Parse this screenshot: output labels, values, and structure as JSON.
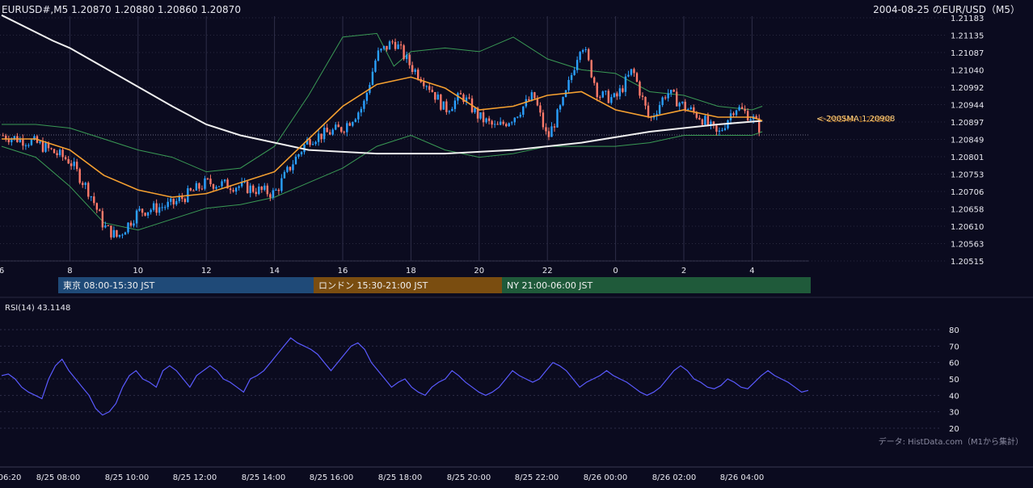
{
  "header": {
    "symbol_line": "EURUSD#,M5 1.20870 1.20880 1.20860 1.20870",
    "title": "2004-08-25 のEUR/USD（M5）"
  },
  "price_axis_labels": [
    "1.21183",
    "1.21135",
    "1.21087",
    "1.21040",
    "1.20992",
    "1.20944",
    "1.20897",
    "1.20849",
    "1.20801",
    "1.20753",
    "1.20706",
    "1.20658",
    "1.20610",
    "1.20563",
    "1.20515"
  ],
  "hour_axis_labels": [
    "6",
    "8",
    "10",
    "12",
    "14",
    "16",
    "18",
    "20",
    "22",
    "0",
    "2",
    "4"
  ],
  "ma_label": "<-200SMA 1.20908",
  "ma_label_shadow": "<-20SMA 1.20900",
  "sessions": [
    {
      "label": "東京 08:00-15:30 JST",
      "color": "#1f4a78"
    },
    {
      "label": "ロンドン 15:30-21:00 JST",
      "color": "#7a4d10"
    },
    {
      "label": "NY 21:00-06:00 JST",
      "color": "#1f5a3a"
    }
  ],
  "rsi": {
    "label": "RSI(14) 43.1148",
    "axis_labels": [
      "80",
      "70",
      "60",
      "50",
      "40",
      "30",
      "20"
    ]
  },
  "source_note": "データ: HistData.com（M1から集計）",
  "time_axis_labels": [
    "06:20",
    "8/25 08:00",
    "8/25 10:00",
    "8/25 12:00",
    "8/25 14:00",
    "8/25 16:00",
    "8/25 18:00",
    "8/25 20:00",
    "8/25 22:00",
    "8/26 00:00",
    "8/26 02:00",
    "8/26 04:00"
  ],
  "colors": {
    "up": "#2aa0ff",
    "down": "#ff7a6a",
    "sma20": "#f5a030",
    "sma200": "#f0f0f0",
    "band": "#3a9a55",
    "rsi": "#5a5aff"
  },
  "chart_data": [
    {
      "type": "candlestick",
      "title": "2004-08-25 のEUR/USD（M5）",
      "ylim": [
        1.20515,
        1.21183
      ],
      "x_range": [
        "8/25 06:20",
        "8/26 05:50"
      ],
      "series": [
        {
          "name": "200SMA",
          "points": [
            [
              0,
              1.2119
            ],
            [
              1.5,
              1.2112
            ],
            [
              2,
              1.211
            ],
            [
              3.5,
              1.2102
            ],
            [
              5,
              1.2094
            ],
            [
              6,
              1.2089
            ],
            [
              7,
              1.2086
            ],
            [
              9,
              1.2082
            ],
            [
              11,
              1.2081
            ],
            [
              13,
              1.2081
            ],
            [
              15,
              1.2082
            ],
            [
              17,
              1.2084
            ],
            [
              19,
              1.2087
            ],
            [
              21,
              1.2089
            ],
            [
              22.3,
              1.209
            ]
          ]
        },
        {
          "name": "20SMA",
          "points": [
            [
              0,
              1.2085
            ],
            [
              1,
              1.2085
            ],
            [
              2,
              1.2082
            ],
            [
              3,
              1.2075
            ],
            [
              4,
              1.2071
            ],
            [
              5,
              1.2069
            ],
            [
              6,
              1.207
            ],
            [
              7,
              1.2073
            ],
            [
              8,
              1.2076
            ],
            [
              9,
              1.2085
            ],
            [
              10,
              1.2094
            ],
            [
              11,
              1.21
            ],
            [
              12,
              1.2102
            ],
            [
              13,
              1.2099
            ],
            [
              14,
              1.2093
            ],
            [
              15,
              1.2094
            ],
            [
              16,
              1.2097
            ],
            [
              17,
              1.2098
            ],
            [
              18,
              1.2093
            ],
            [
              19,
              1.2091
            ],
            [
              20,
              1.2093
            ],
            [
              21,
              1.2091
            ],
            [
              22,
              1.2091
            ],
            [
              22.3,
              1.209
            ]
          ]
        },
        {
          "name": "upper_band",
          "points": [
            [
              0,
              1.2089
            ],
            [
              1,
              1.2089
            ],
            [
              2,
              1.2088
            ],
            [
              3,
              1.2085
            ],
            [
              4,
              1.2082
            ],
            [
              5,
              1.208
            ],
            [
              6,
              1.2076
            ],
            [
              7,
              1.2077
            ],
            [
              8,
              1.2083
            ],
            [
              9,
              1.2097
            ],
            [
              10,
              1.2113
            ],
            [
              11,
              1.2114
            ],
            [
              11.5,
              1.2105
            ],
            [
              12,
              1.2109
            ],
            [
              13,
              1.211
            ],
            [
              14,
              1.2109
            ],
            [
              15,
              1.2113
            ],
            [
              16,
              1.2107
            ],
            [
              17,
              1.2104
            ],
            [
              18,
              1.2103
            ],
            [
              19,
              1.2098
            ],
            [
              20,
              1.2097
            ],
            [
              21,
              1.2094
            ],
            [
              22,
              1.2093
            ],
            [
              22.3,
              1.2094
            ]
          ]
        },
        {
          "name": "lower_band",
          "points": [
            [
              0,
              1.2083
            ],
            [
              1,
              1.208
            ],
            [
              2,
              1.2072
            ],
            [
              3,
              1.2062
            ],
            [
              4,
              1.206
            ],
            [
              5,
              1.2063
            ],
            [
              6,
              1.2066
            ],
            [
              7,
              1.2067
            ],
            [
              8,
              1.2069
            ],
            [
              9,
              1.2073
            ],
            [
              10,
              1.2077
            ],
            [
              11,
              1.2083
            ],
            [
              12,
              1.2086
            ],
            [
              13,
              1.2082
            ],
            [
              14,
              1.208
            ],
            [
              15,
              1.2081
            ],
            [
              16,
              1.2083
            ],
            [
              17,
              1.2083
            ],
            [
              18,
              1.2083
            ],
            [
              19,
              1.2084
            ],
            [
              20,
              1.2086
            ],
            [
              21,
              1.2086
            ],
            [
              22,
              1.2086
            ],
            [
              22.3,
              1.2087
            ]
          ]
        }
      ],
      "close_path": [
        [
          0,
          1.2086
        ],
        [
          1,
          1.2084
        ],
        [
          2,
          1.2079
        ],
        [
          2.6,
          1.207
        ],
        [
          3,
          1.2061
        ],
        [
          3.4,
          1.2058
        ],
        [
          4,
          1.2065
        ],
        [
          5,
          1.2067
        ],
        [
          6,
          1.2073
        ],
        [
          7,
          1.2072
        ],
        [
          8,
          1.207
        ],
        [
          8.5,
          1.2078
        ],
        [
          9,
          1.2085
        ],
        [
          10,
          1.2088
        ],
        [
          10.6,
          1.2094
        ],
        [
          11,
          1.2108
        ],
        [
          11.5,
          1.2112
        ],
        [
          12,
          1.2105
        ],
        [
          12.5,
          1.21
        ],
        [
          13,
          1.2093
        ],
        [
          13.5,
          1.2097
        ],
        [
          14,
          1.2091
        ],
        [
          14.5,
          1.2088
        ],
        [
          15,
          1.2091
        ],
        [
          15.6,
          1.2097
        ],
        [
          16,
          1.2085
        ],
        [
          16.5,
          1.2096
        ],
        [
          17,
          1.2112
        ],
        [
          17.5,
          1.2097
        ],
        [
          18,
          1.2096
        ],
        [
          18.5,
          1.2104
        ],
        [
          19,
          1.209
        ],
        [
          19.5,
          1.2098
        ],
        [
          20,
          1.2094
        ],
        [
          20.5,
          1.2091
        ],
        [
          21,
          1.2086
        ],
        [
          21.5,
          1.2094
        ],
        [
          22,
          1.2091
        ],
        [
          22.3,
          1.2087
        ]
      ]
    },
    {
      "type": "line",
      "name": "RSI(14)",
      "ylim": [
        20,
        80
      ],
      "values": [
        52,
        53,
        50,
        45,
        42,
        40,
        38,
        50,
        58,
        62,
        55,
        50,
        45,
        40,
        32,
        28,
        30,
        35,
        45,
        52,
        55,
        50,
        48,
        45,
        55,
        58,
        55,
        50,
        45,
        52,
        55,
        58,
        55,
        50,
        48,
        45,
        42,
        50,
        52,
        55,
        60,
        65,
        70,
        75,
        72,
        70,
        68,
        65,
        60,
        55,
        60,
        65,
        70,
        72,
        68,
        60,
        55,
        50,
        45,
        48,
        50,
        45,
        42,
        40,
        45,
        48,
        50,
        55,
        52,
        48,
        45,
        42,
        40,
        42,
        45,
        50,
        55,
        52,
        50,
        48,
        50,
        55,
        60,
        58,
        55,
        50,
        45,
        48,
        50,
        52,
        55,
        52,
        50,
        48,
        45,
        42,
        40,
        42,
        45,
        50,
        55,
        58,
        55,
        50,
        48,
        45,
        44,
        46,
        50,
        48,
        45,
        44,
        48,
        52,
        55,
        52,
        50,
        48,
        45,
        42,
        43
      ]
    }
  ]
}
